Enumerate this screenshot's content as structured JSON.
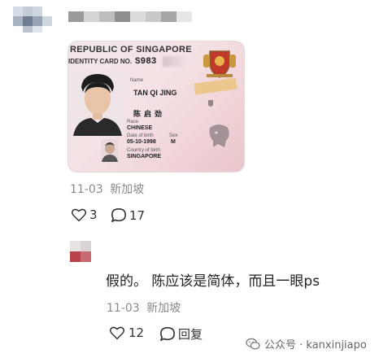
{
  "comment1": {
    "card": {
      "header_line1": "REPUBLIC OF SINGAPORE",
      "header_line2": "IDENTITY CARD NO.",
      "card_number": "S983",
      "name_label": "Name",
      "name": "TAN QI JING",
      "chinese_name": "陈启劲",
      "race_label": "Race",
      "race": "CHINESE",
      "dob_label": "Date of birth",
      "dob": "05-10-1998",
      "sex_label": "Sex",
      "sex": "M",
      "country_label": "Country of birth",
      "country": "SINGAPORE"
    },
    "time": "11-03",
    "location": "新加坡",
    "like_count": "3",
    "reply_count": "17"
  },
  "comment2": {
    "text": "假的。 陈应该是简体，而且一眼ps",
    "time": "11-03",
    "location": "新加坡",
    "like_count": "12",
    "reply_label": "回复"
  },
  "watermark": {
    "label": "公众号 · kanxinjiapo"
  }
}
